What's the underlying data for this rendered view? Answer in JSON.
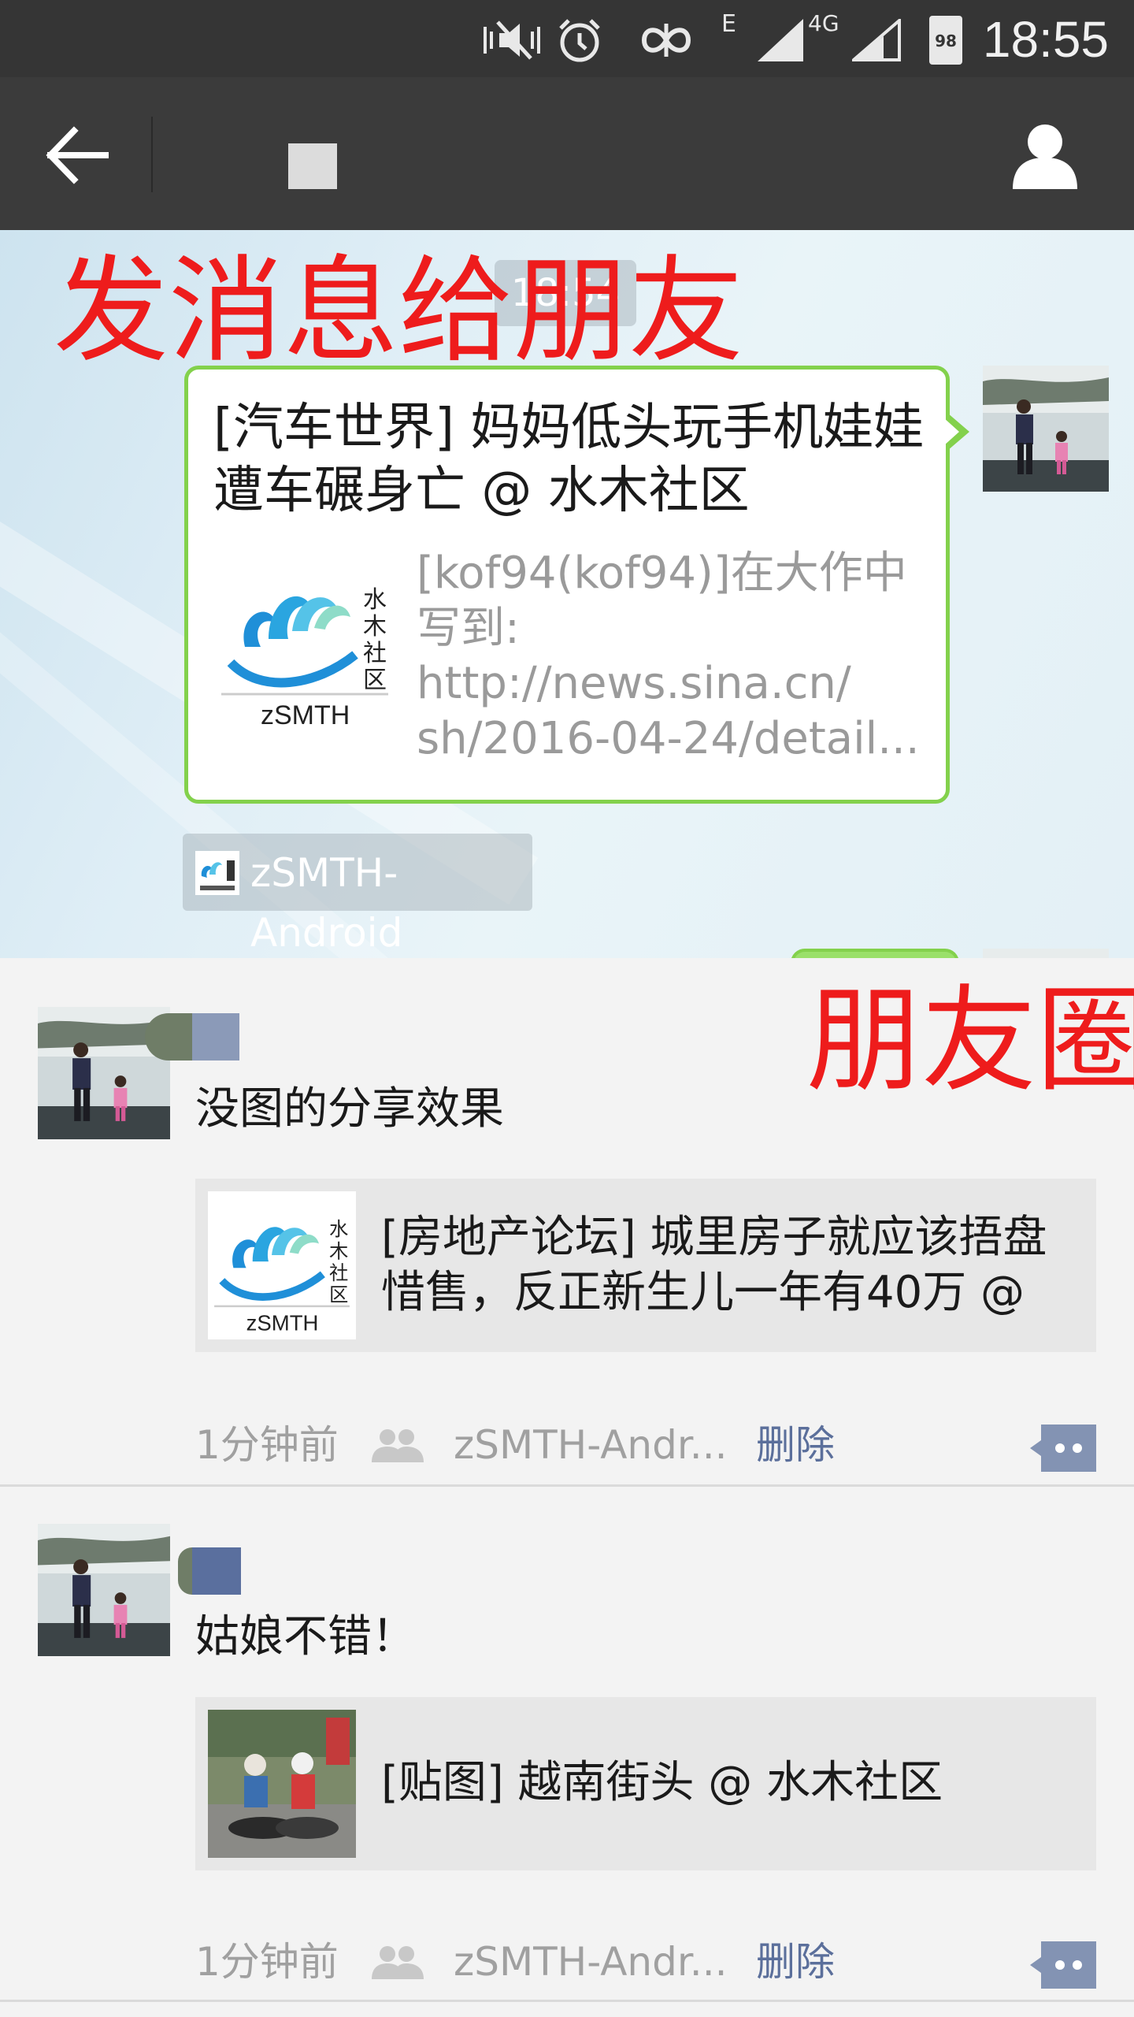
{
  "status_bar": {
    "time": "18:55",
    "battery": "98",
    "network": "4G",
    "edge": "E",
    "icons": [
      "mute-vibrate-icon",
      "alarm-icon",
      "unicom-icon",
      "signal-icon",
      "battery-icon"
    ]
  },
  "title_bar": {
    "back_icon": "arrow-left-icon",
    "contact_icon": "person-icon"
  },
  "chat": {
    "timestamp": "18:54",
    "overlay_label": "发消息给朋友",
    "message": {
      "title": "[汽车世界] 妈妈低头玩手机娃娃遭车碾身亡 @ 水木社区",
      "description": "[kof94(kof94)]在大作中\n写到:\nhttp://news.sina.cn/\nsh/2016-04-24/detail...",
      "thumb_brand": "zSMTH",
      "thumb_cn": "水木社区"
    },
    "source_label": "zSMTH-Android"
  },
  "moments": {
    "overlay_label": "朋友圈",
    "posts": [
      {
        "text": "没图的分享效果",
        "share_title": "[房地产论坛] 城里房子就应该捂盘惜售，反正新生儿一年有40万 @",
        "share_thumb_brand": "zSMTH",
        "share_thumb_cn": "水木社区",
        "time": "1分钟前",
        "source": "zSMTH-Andr...",
        "delete_label": "删除"
      },
      {
        "text": "姑娘不错！",
        "share_title": "[贴图] 越南街头 @ 水木社区",
        "time": "1分钟前",
        "source": "zSMTH-Andr...",
        "delete_label": "删除"
      }
    ]
  },
  "colors": {
    "accent_green": "#83d14c",
    "overlay_red": "#ee1c1c",
    "link_blue": "#5b6f9b",
    "bar_dark": "#3b3b3b"
  }
}
